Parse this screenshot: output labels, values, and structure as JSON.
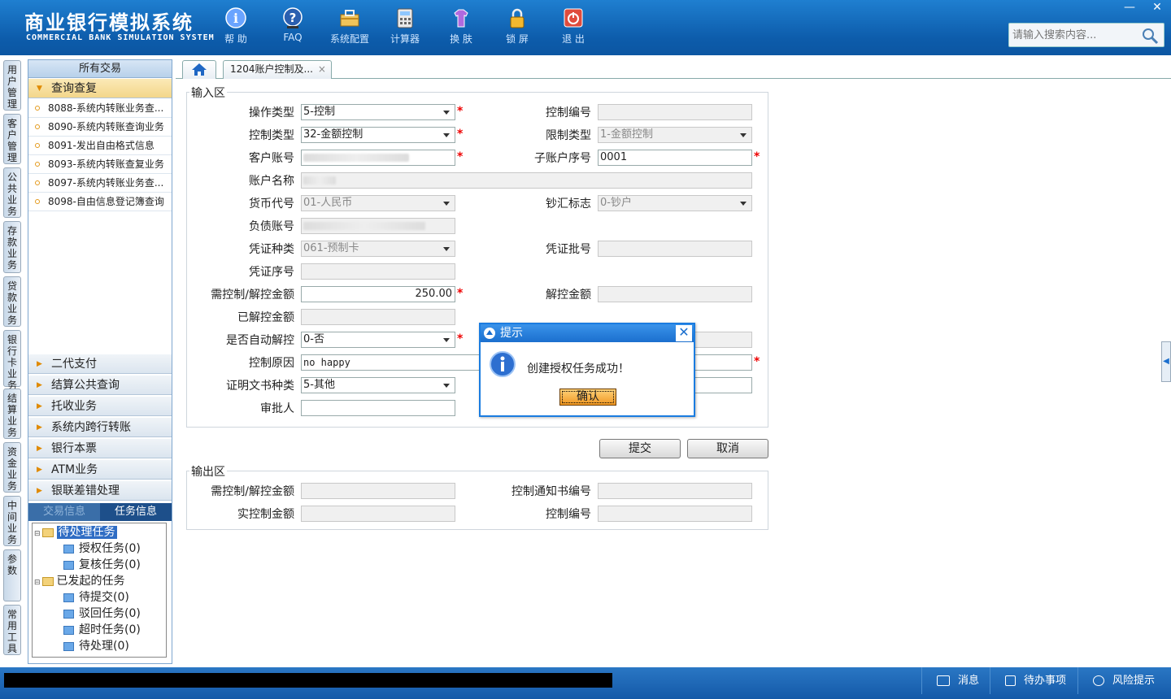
{
  "app": {
    "title_cn": "商业银行模拟系统",
    "title_en": "COMMERCIAL BANK SIMULATION SYSTEM"
  },
  "toolbar": [
    {
      "label": "帮 助",
      "icon": "info-icon"
    },
    {
      "label": "FAQ",
      "icon": "faq-icon"
    },
    {
      "label": "系统配置",
      "icon": "toolbox-icon"
    },
    {
      "label": "计算器",
      "icon": "calculator-icon"
    },
    {
      "label": "换 肤",
      "icon": "skin-icon"
    },
    {
      "label": "锁 屏",
      "icon": "lock-icon"
    },
    {
      "label": "退 出",
      "icon": "power-icon"
    }
  ],
  "window": {
    "minimize": "—",
    "close": "✕"
  },
  "search": {
    "placeholder": "请输入搜索内容..."
  },
  "vtabs": [
    "用户管理",
    "客户管理",
    "公共业务",
    "存款业务",
    "贷款业务",
    "银行卡业务",
    "结算业务",
    "资金业务",
    "中间业务",
    "参数",
    "常用工具"
  ],
  "nav": {
    "header": "所有交易",
    "open_group": "查询查复",
    "items": [
      "8088-系统内转账业务查...",
      "8090-系统内转账查询业务",
      "8091-发出自由格式信息",
      "8093-系统内转账查复业务",
      "8097-系统内转账业务查...",
      "8098-自由信息登记簿查询"
    ],
    "groups": [
      "二代支付",
      "结算公共查询",
      "托收业务",
      "系统内跨行转账",
      "银行本票",
      "ATM业务",
      "银联差错处理"
    ]
  },
  "lower_tabs": {
    "trade_info": "交易信息",
    "task_info": "任务信息"
  },
  "tree": {
    "pending": "待处理任务",
    "auth": "授权任务(0)",
    "review": "复核任务(0)",
    "initiated": "已发起的任务",
    "to_submit": "待提交(0)",
    "rejected": "驳回任务(0)",
    "timeout": "超时任务(0)",
    "to_process": "待处理(0)"
  },
  "tabs": {
    "active_tab": "1204账户控制及...",
    "close": "×"
  },
  "input_section": {
    "legend": "输入区",
    "op_type_label": "操作类型",
    "op_type": "5-控制",
    "ctrl_no_label": "控制编号",
    "ctrl_no": "",
    "ctrl_type_label": "控制类型",
    "ctrl_type": "32-金额控制",
    "limit_type_label": "限制类型",
    "limit_type": "1-金额控制",
    "cust_acct_label": "客户账号",
    "sub_acct_label": "子账户序号",
    "sub_acct": "0001",
    "acct_name_label": "账户名称",
    "currency_label": "货币代号",
    "currency": "01-人民币",
    "cash_flag_label": "钞汇标志",
    "cash_flag": "0-钞户",
    "liability_label": "负债账号",
    "voucher_type_label": "凭证种类",
    "voucher_type": "061-预制卡",
    "voucher_batch_label": "凭证批号",
    "voucher_batch": "",
    "voucher_seq_label": "凭证序号",
    "voucher_seq": "",
    "amount_label": "需控制/解控金额",
    "amount": "250.00",
    "release_amt_label": "解控金额",
    "release_amt": "",
    "released_label": "已解控金额",
    "released": "",
    "auto_release_label": "是否自动解控",
    "auto_release": "0-否",
    "reason_label": "控制原因",
    "reason": "no happy",
    "cert_type_label": "证明文书种类",
    "cert_type": "5-其他",
    "approver_label": "审批人",
    "approver": ""
  },
  "buttons": {
    "submit": "提交",
    "cancel": "取消"
  },
  "output_section": {
    "legend": "输出区",
    "amount_label": "需控制/解控金额",
    "amount": "",
    "notice_no_label": "控制通知书编号",
    "notice_no": "",
    "actual_label": "实控制金额",
    "actual": "",
    "ctrl_no_label": "控制编号",
    "ctrl_no": ""
  },
  "dialog": {
    "title": "提示",
    "message": "创建授权任务成功！",
    "ok": "确认",
    "close": "✕"
  },
  "status": {
    "messages": "消息",
    "todo": "待办事项",
    "risk": "风险提示"
  },
  "colors": {
    "header_blue": "#0d5cab",
    "required": "#ee0000",
    "dialog_border": "#1a7ce0",
    "ok_orange": "#f09722"
  }
}
